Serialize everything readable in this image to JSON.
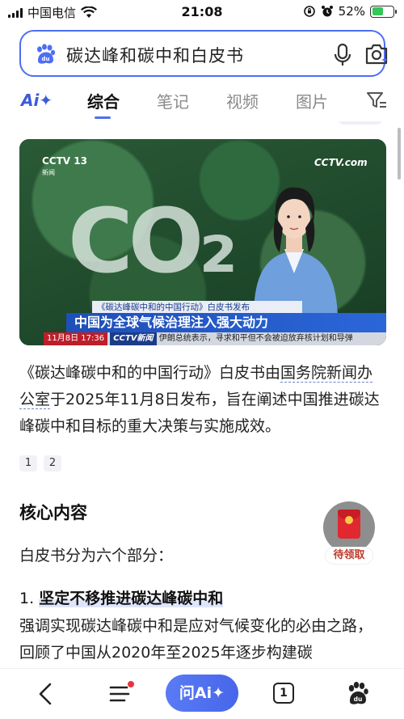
{
  "status_bar": {
    "carrier": "中国电信",
    "time": "21:08",
    "battery": "52%",
    "battery_level": 0.52
  },
  "search": {
    "query": "碳达峰和碳中和白皮书"
  },
  "tabs": {
    "ai": "Ai✦",
    "items": [
      "综合",
      "笔记",
      "视频",
      "图片"
    ],
    "active": "综合"
  },
  "video": {
    "channel_left": "CCTV 13",
    "channel_left_sub": "新闻",
    "channel_right": "CCTV.com",
    "overlay_text": "CO₂",
    "caption_top": "《碳达峰碳中和的中国行动》白皮书发布",
    "caption_main": "中国为全球气候治理注入强大动力",
    "ticker_date": "11月8日 17:36",
    "ticker_logo": "CCTV新闻",
    "ticker_text": "伊朗总统表示，寻求和平但不会被迫放弃核计划和导弹"
  },
  "summary": {
    "part1": "《碳达峰碳中和的中国行动》白皮书由",
    "link": "国务院新闻办公室",
    "part2": "于2025年11月8日发布，旨在阐述中国推进碳达峰碳中和目标的重大决策与实施成效。"
  },
  "refs": [
    "1",
    "2"
  ],
  "core_section": {
    "heading": "核心内容",
    "intro": "白皮书分为六个部分：",
    "item1_number": "1.",
    "item1_title": "坚定不移推进碳达峰碳中和",
    "item1_desc": "强调实现碳达峰碳中和是应对气候变化的必由之路，回顾了中国从2020年至2025年逐步构建碳"
  },
  "red_packet": {
    "label": "待领取"
  },
  "bottom_bar": {
    "ask_ai": "问Ai✦",
    "tab_count": "1"
  }
}
